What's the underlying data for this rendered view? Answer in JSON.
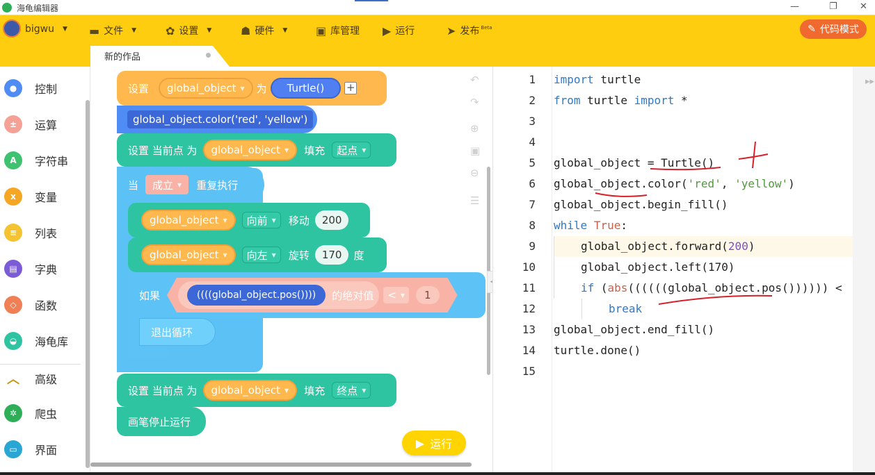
{
  "window": {
    "title": "海龟编辑器",
    "controls": [
      "—",
      "❐",
      "✕"
    ]
  },
  "toolbar": {
    "user": "bigwu",
    "file": "文件",
    "settings": "设置",
    "hardware": "硬件",
    "library": "库管理",
    "run": "运行",
    "publish": "发布",
    "publish_tag": "Beta",
    "code_mode": "代码模式"
  },
  "tab": {
    "name": "新的作品"
  },
  "sidebar": {
    "items": [
      {
        "label": "控制",
        "color": "#4f8df5"
      },
      {
        "label": "运算",
        "color": "#f6a196"
      },
      {
        "label": "字符串",
        "color": "#3ec270"
      },
      {
        "label": "变量",
        "color": "#f5a623"
      },
      {
        "label": "列表",
        "color": "#f5c332"
      },
      {
        "label": "字典",
        "color": "#7c5bd6"
      },
      {
        "label": "函数",
        "color": "#f07f55"
      },
      {
        "label": "海龟库",
        "color": "#2ec4a1"
      },
      {
        "label": "高级",
        "color": "#c9940f"
      },
      {
        "label": "爬虫",
        "color": "#2fae58"
      },
      {
        "label": "界面",
        "color": "#2aa6d4"
      }
    ]
  },
  "blocks": {
    "b1": {
      "set": "设置",
      "var": "global_object",
      "as": "为",
      "value": "Turtle()"
    },
    "b2": {
      "text": "global_object.color('red', 'yellow')"
    },
    "b3": {
      "label": "设置 当前点 为",
      "var": "global_object",
      "fill": "填充",
      "opt": "起点"
    },
    "b4": {
      "while": "当",
      "cond": "成立",
      "repeat": "重复执行"
    },
    "b5": {
      "var": "global_object",
      "dir": "向前",
      "action": "移动",
      "value": "200"
    },
    "b6": {
      "var": "global_object",
      "dir": "向左",
      "action": "旋转",
      "value": "170",
      "unit": "度"
    },
    "b7": {
      "if": "如果",
      "expr": "((((global_object.pos())))",
      "abs": "的绝对值",
      "op": "<",
      "value": "1"
    },
    "b8": {
      "text": "退出循环"
    },
    "b9": {
      "label": "设置 当前点 为",
      "var": "global_object",
      "fill": "填充",
      "opt": "终点"
    },
    "b10": {
      "text": "画笔停止运行"
    }
  },
  "run_button": "运行",
  "code": {
    "line_numbers": [
      "1",
      "2",
      "3",
      "4",
      "5",
      "6",
      "7",
      "8",
      "9",
      "10",
      "11",
      "12",
      "13",
      "14",
      "15"
    ],
    "l1": {
      "kw": "import",
      "rest": " turtle"
    },
    "l2": {
      "kw1": "from",
      "mid": " turtle ",
      "kw2": "import",
      "rest": " *"
    },
    "l5": "global_object = Turtle()",
    "l6": {
      "a": "global_object.color(",
      "s1": "'red'",
      "c": ", ",
      "s2": "'yellow'",
      "b": ")"
    },
    "l7": "global_object.begin_fill()",
    "l8": {
      "kw": "while",
      "sp": " ",
      "tr": "True",
      "rest": ":"
    },
    "l9": {
      "a": "global_object.forward(",
      "n": "200",
      "b": ")"
    },
    "l10": "global_object.left(170)",
    "l11": {
      "kw": "if",
      "a": " (",
      "f": "abs",
      "b": "((((((global_object.pos()))))) <"
    },
    "l12": {
      "kw": "break"
    },
    "l13": "global_object.end_fill()",
    "l14": "turtle.done()"
  }
}
